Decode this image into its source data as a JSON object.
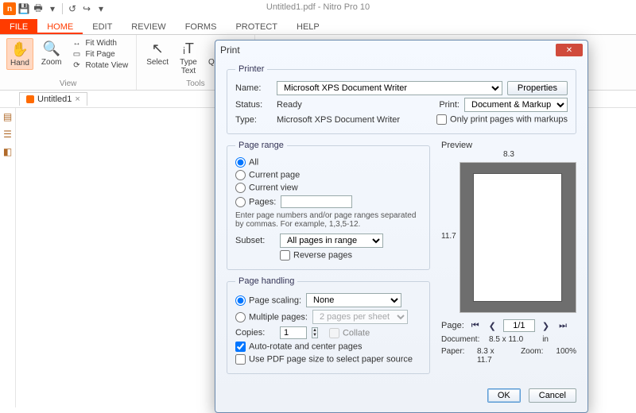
{
  "app": {
    "title": "Untitled1.pdf - Nitro Pro 10"
  },
  "qat": {
    "save": "💾",
    "print": "🖶",
    "undo": "↺",
    "redo": "↻"
  },
  "tabs": {
    "file": "FILE",
    "home": "HOME",
    "edit": "EDIT",
    "review": "REVIEW",
    "forms": "FORMS",
    "protect": "PROTECT",
    "help": "HELP"
  },
  "ribbon": {
    "hand": "Hand",
    "zoom": "Zoom",
    "fitwidth": "Fit Width",
    "fitpage": "Fit Page",
    "rotateview": "Rotate View",
    "select": "Select",
    "typetext": "Type\nText",
    "quicksign": "QuickSign",
    "group_view": "View",
    "group_tools": "Tools"
  },
  "doc": {
    "name": "Untitled1",
    "close": "×"
  },
  "dialog": {
    "title": "Print",
    "printer": {
      "legend": "Printer",
      "name_label": "Name:",
      "name_value": "Microsoft XPS Document Writer",
      "properties": "Properties",
      "status_label": "Status:",
      "status_value": "Ready",
      "type_label": "Type:",
      "type_value": "Microsoft XPS Document Writer",
      "print_label": "Print:",
      "print_value": "Document & Markups",
      "only_markups": "Only print pages with markups"
    },
    "range": {
      "legend": "Page range",
      "all": "All",
      "current_page": "Current page",
      "current_view": "Current view",
      "pages": "Pages:",
      "note": "Enter page numbers and/or page ranges separated by commas. For example, 1,3,5-12.",
      "subset_label": "Subset:",
      "subset_value": "All pages in range",
      "reverse": "Reverse pages"
    },
    "preview": {
      "legend": "Preview",
      "width": "8.3",
      "height": "11.7"
    },
    "handling": {
      "legend": "Page handling",
      "scaling_label": "Page scaling:",
      "scaling_value": "None",
      "multiple_label": "Multiple pages:",
      "multiple_value": "2 pages per sheet",
      "copies_label": "Copies:",
      "copies_value": "1",
      "collate": "Collate",
      "autorotate": "Auto-rotate and center pages",
      "usepdfsize": "Use PDF page size to select paper source"
    },
    "navinfo": {
      "page_label": "Page:",
      "page_value": "1/1",
      "doc_label": "Document:",
      "doc_value": "8.5 x 11.0",
      "doc_unit": "in",
      "paper_label": "Paper:",
      "paper_value": "8.3 x 11.7",
      "zoom_label": "Zoom:",
      "zoom_value": "100%"
    },
    "ok": "OK",
    "cancel": "Cancel"
  }
}
